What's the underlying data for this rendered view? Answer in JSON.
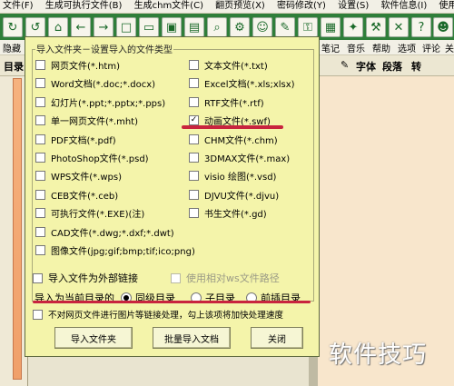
{
  "menubar": [
    "文件(F)",
    "生成可执行文件(B)",
    "生成chm文件(C)",
    "翻页预览(X)",
    "密码修改(Y)",
    "设置(S)",
    "软件信息(I)",
    "使用帮"
  ],
  "toolbar": {
    "icons": [
      "refresh-icon",
      "refresh2-icon",
      "home-icon",
      "back-icon",
      "forward-icon",
      "new-file-icon",
      "open-folder-icon",
      "save-icon",
      "save-as-icon",
      "search-icon",
      "settings-icon",
      "user-icon",
      "plugin-icon",
      "lock-icon",
      "image-icon",
      "flash-icon",
      "tool-icon",
      "close-icon",
      "help-icon",
      "smiley-icon"
    ]
  },
  "row2": {
    "left": "隐藏",
    "right": [
      "笔记",
      "音乐",
      "帮助",
      "选项",
      "评论",
      "关"
    ]
  },
  "row3": {
    "left": "目录",
    "right": [
      "字体",
      "段落",
      "转"
    ]
  },
  "dialog": {
    "group_title": "导入文件夹－设置导入的文件类型",
    "left_types": [
      {
        "label": "网页文件(*.htm)",
        "checked": false
      },
      {
        "label": "Word文档(*.doc;*.docx)",
        "checked": false
      },
      {
        "label": "幻灯片(*.ppt;*.pptx;*.pps)",
        "checked": false
      },
      {
        "label": "单一网页文件(*.mht)",
        "checked": false
      },
      {
        "label": "PDF文档(*.pdf)",
        "checked": false
      },
      {
        "label": "PhotoShop文件(*.psd)",
        "checked": false
      },
      {
        "label": "WPS文件(*.wps)",
        "checked": false
      },
      {
        "label": "CEB文件(*.ceb)",
        "checked": false
      },
      {
        "label": "可执行文件(*.EXE)(注)",
        "checked": false
      },
      {
        "label": "CAD文件(*.dwg;*.dxf;*.dwt)",
        "checked": false
      },
      {
        "label": "图像文件(jpg;gif;bmp;tif;ico;png)",
        "checked": false
      }
    ],
    "right_types": [
      {
        "label": "文本文件(*.txt)",
        "checked": false
      },
      {
        "label": "Excel文档(*.xls;xlsx)",
        "checked": false
      },
      {
        "label": "RTF文件(*.rtf)",
        "checked": false
      },
      {
        "label": "动画文件(*.swf)",
        "checked": true
      },
      {
        "label": "CHM文件(*.chm)",
        "checked": false
      },
      {
        "label": "3DMAX文件(*.max)",
        "checked": false
      },
      {
        "label": "visio 绘图(*.vsd)",
        "checked": false
      },
      {
        "label": "DJVU文件(*.djvu)",
        "checked": false
      },
      {
        "label": "书生文件(*.gd)",
        "checked": false
      }
    ],
    "external_link": "导入文件为外部链接",
    "relative_path": "使用相对ws文件路径",
    "import_as_label": "导入为当前目录的",
    "radio_options": [
      {
        "label": "同级目录",
        "selected": true
      },
      {
        "label": "子目录",
        "selected": false
      },
      {
        "label": "前插目录",
        "selected": false
      }
    ],
    "no_process": "不对网页文件进行图片等链接处理，勾上该项将加快处理速度",
    "buttons": {
      "import_folder": "导入文件夹",
      "batch_import": "批量导入文档",
      "close": "关闭"
    }
  },
  "watermark": "软件技巧",
  "colors": {
    "toolbar": "#2f7e3a",
    "dialog": "#f4f4aa",
    "annotation": "#c8243e"
  }
}
